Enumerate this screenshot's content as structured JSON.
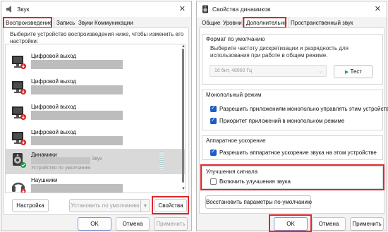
{
  "left_window": {
    "title": "Звук",
    "tabs": [
      "Воспроизведение",
      "Запись",
      "Звуки",
      "Коммуникации"
    ],
    "description": "Выберите устройство воспроизведения ниже, чтобы изменить его настройки:",
    "devices": [
      {
        "name": "Цифровой выход"
      },
      {
        "name": "Цифровой выход"
      },
      {
        "name": "Цифровой выход"
      },
      {
        "name": "Цифровой выход"
      },
      {
        "name": "Динамики",
        "sub": "Звук",
        "status": "Устройство по умолчанию"
      },
      {
        "name": "Наушники"
      }
    ],
    "buttons": {
      "configure": "Настройка",
      "set_default": "Установить по умолчанию",
      "properties": "Свойства",
      "ok": "OK",
      "cancel": "Отмена",
      "apply": "Применить"
    }
  },
  "right_window": {
    "title": "Свойства динамиков",
    "tabs": [
      "Общие",
      "Уровни",
      "Дополнительно",
      "Пространственный звук"
    ],
    "default_format": {
      "title": "Формат по умолчанию",
      "description": "Выберите частоту дискретизации и разрядность для использования при работе в общем режиме.",
      "selected": "16 бит, 48000 Гц",
      "test_button": "Тест"
    },
    "exclusive_mode": {
      "title": "Монопольный режим",
      "options": [
        {
          "label": "Разрешить приложениям монопольно управлять этим устройством",
          "checked": true
        },
        {
          "label": "Приоритет приложений в монопольном режиме",
          "checked": true
        }
      ]
    },
    "hardware_acceleration": {
      "title": "Аппаратное ускорение",
      "option": {
        "label": "Разрешить аппаратное ускорение звука на этом устройстве",
        "checked": true
      }
    },
    "enhancements": {
      "title": "Улучшения сигнала",
      "option": {
        "label": "Включить улучшения звука",
        "checked": false
      }
    },
    "restore_button": "Восстановить параметры по-умолчанию",
    "buttons": {
      "ok": "OK",
      "cancel": "Отмена",
      "apply": "Применить"
    }
  },
  "colors": {
    "highlight": "#e0262d",
    "accent": "#1f5bc6",
    "test_icon": "#1aa36b"
  }
}
